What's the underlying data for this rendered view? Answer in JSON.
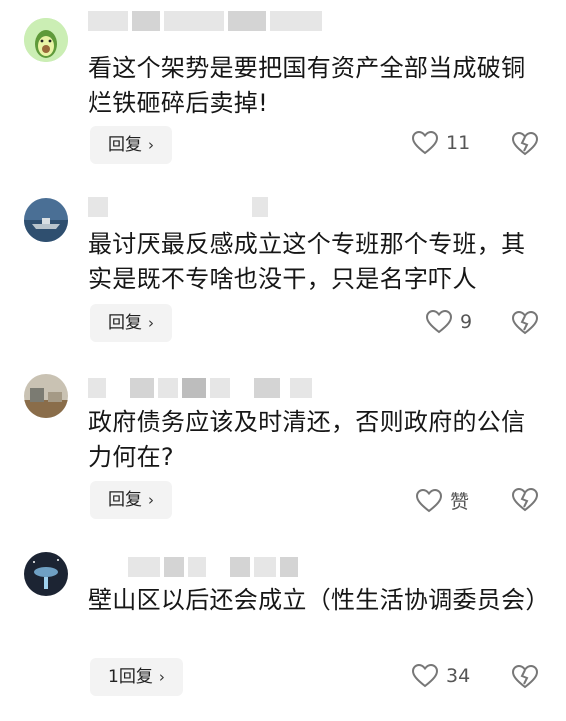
{
  "comments": [
    {
      "text": "看这个架势是要把国有资产全部当成破铜烂铁砸碎后卖掉!",
      "reply_label": "回复",
      "like_count": "11"
    },
    {
      "text": "最讨厌最反感成立这个专班那个专班，其实是既不专啥也没干，只是名字吓人",
      "reply_label": "回复",
      "like_count": "9"
    },
    {
      "text": "政府债务应该及时清还，否则政府的公信力何在?",
      "reply_label": "回复",
      "like_count": "赞"
    },
    {
      "text": "壁山区以后还会成立（性生活协调委员会）",
      "reply_label": "1回复",
      "like_count": "34"
    }
  ],
  "icons": {
    "like": "heart-outline-icon",
    "dislike": "broken-heart-icon",
    "reply_chevron": "chevron-right-icon"
  }
}
